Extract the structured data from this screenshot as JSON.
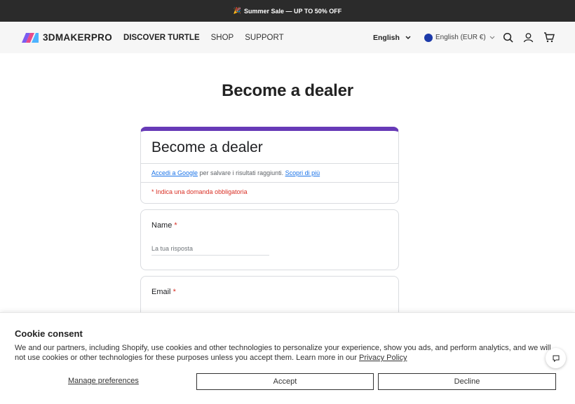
{
  "announcement": {
    "icon": "party-popper-icon",
    "text": "Summer Sale — UP TO 50% OFF"
  },
  "header": {
    "brand": "3DMAKERPRO",
    "nav": [
      {
        "label": "DISCOVER TURTLE",
        "bold": true
      },
      {
        "label": "SHOP"
      },
      {
        "label": "SUPPORT"
      }
    ],
    "language": "English",
    "currency": "English (EUR €)"
  },
  "page": {
    "title": "Become a dealer"
  },
  "form": {
    "title": "Become a dealer",
    "signin_link": "Accedi a Google",
    "signin_text": " per salvare i risultati raggiunti. ",
    "learn_more": "Scopri di più",
    "required_note": "* Indica una domanda obbligatoria",
    "questions": [
      {
        "label": "Name",
        "required": "*",
        "placeholder": "La tua risposta"
      },
      {
        "label": "Email",
        "required": "*"
      }
    ]
  },
  "cookie": {
    "title": "Cookie consent",
    "text": "We and our partners, including Shopify, use cookies and other technologies to personalize your experience, show you ads, and perform analytics, and we will not use cookies or other technologies for these purposes unless you accept them. Learn more in our ",
    "policy_link": "Privacy Policy",
    "manage_label": "Manage preferences",
    "accept_label": "Accept",
    "decline_label": "Decline"
  },
  "colors": {
    "form_accent": "#673ab7",
    "required": "#d93025",
    "link": "#1a73e8",
    "topbar": "#2b2b2b"
  }
}
